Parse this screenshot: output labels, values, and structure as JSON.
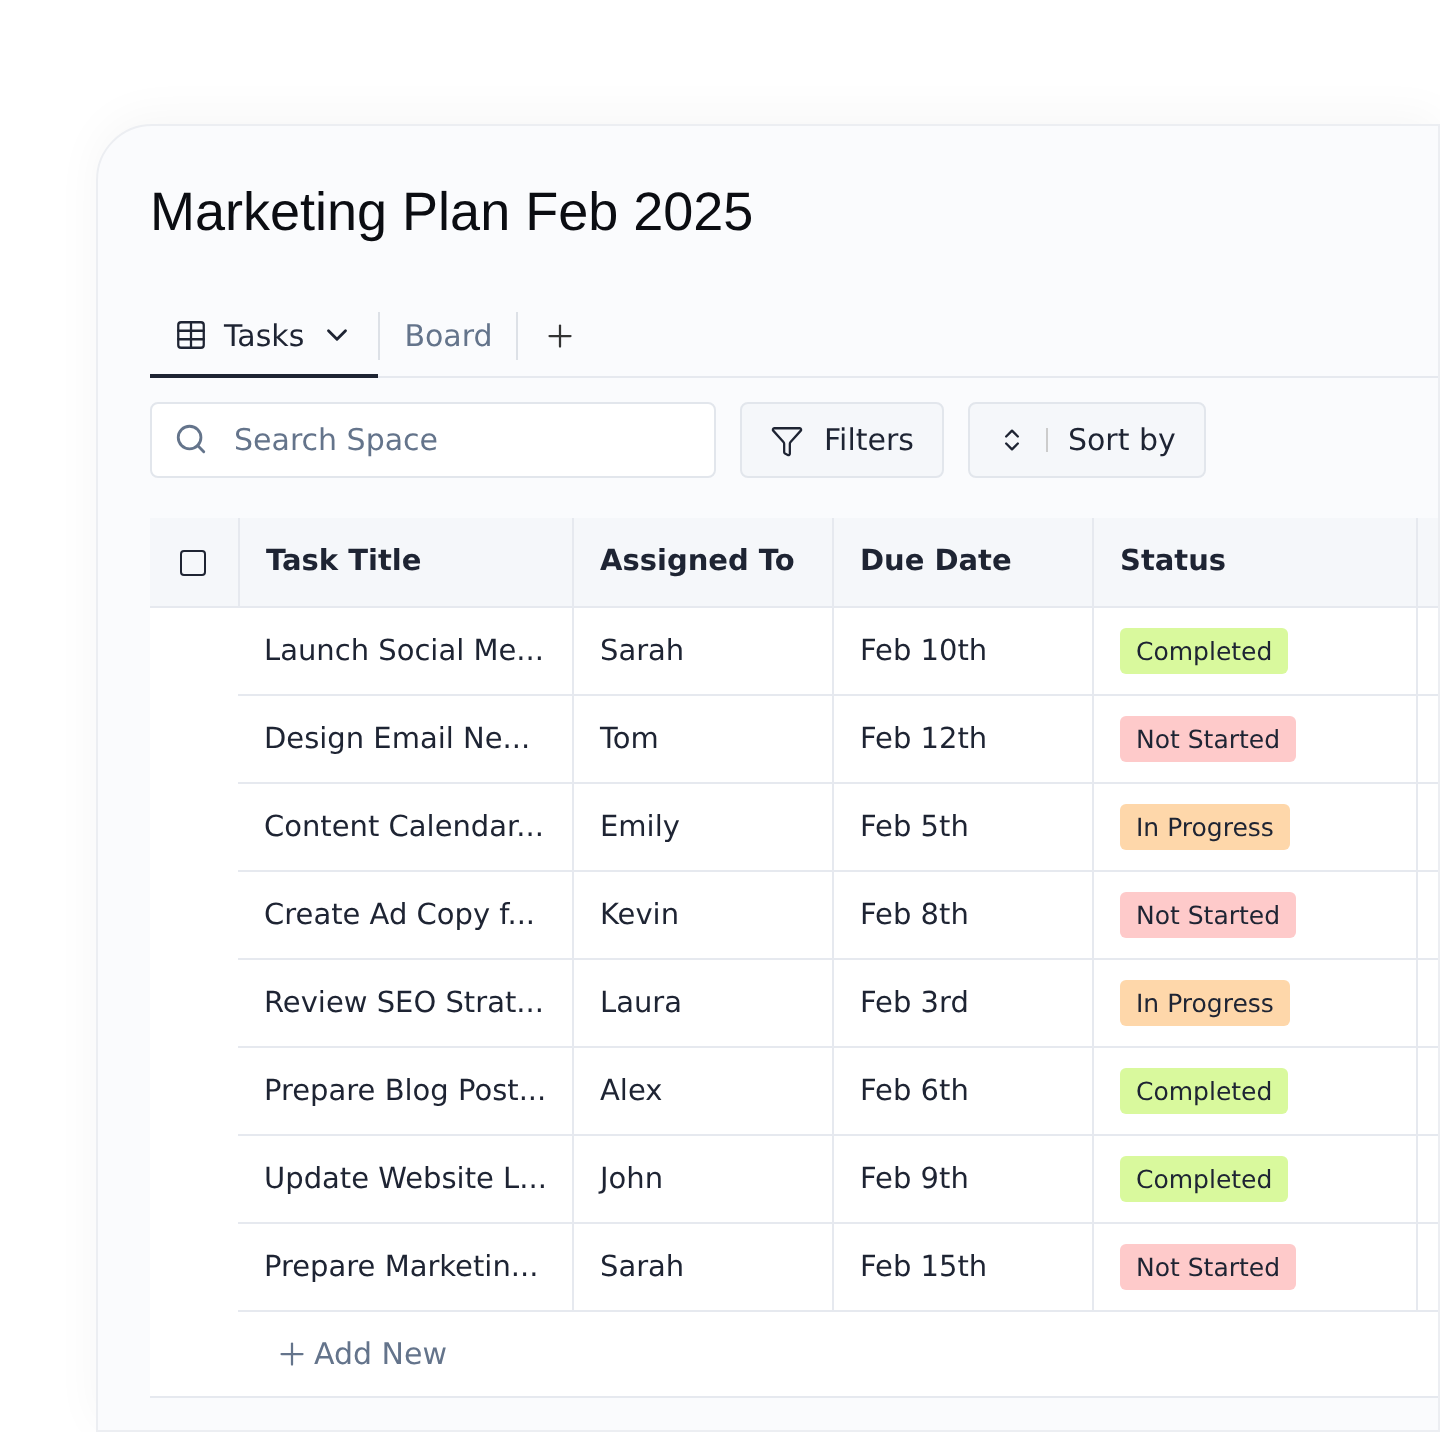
{
  "title": "Marketing Plan Feb 2025",
  "views": [
    {
      "label": "Tasks",
      "kind": "table",
      "selected": true
    },
    {
      "label": "Board",
      "kind": "plain",
      "selected": false
    }
  ],
  "search": {
    "placeholder": "Search Space"
  },
  "filters": {
    "label": "Filters"
  },
  "sort": {
    "label": "Sort by"
  },
  "table": {
    "select_all": {
      "checked": false
    },
    "columns": [
      "Task Title",
      "Assigned To",
      "Due Date",
      "Status"
    ],
    "rows": [
      {
        "title": "Launch Social Me...",
        "assignee": "Sarah",
        "due": "Feb 10th",
        "status": {
          "label": "Completed",
          "color": "#d9f99d"
        }
      },
      {
        "title": "Design Email Ne...",
        "assignee": "Tom",
        "due": "Feb 12th",
        "status": {
          "label": "Not Started",
          "color": "#fecaca"
        }
      },
      {
        "title": "Content Calendar...",
        "assignee": "Emily",
        "due": "Feb 5th",
        "status": {
          "label": "In Progress",
          "color": "#fed7aa"
        }
      },
      {
        "title": "Create Ad Copy f...",
        "assignee": "Kevin",
        "due": "Feb 8th",
        "status": {
          "label": "Not Started",
          "color": "#fecaca"
        }
      },
      {
        "title": "Review SEO Strat...",
        "assignee": "Laura",
        "due": "Feb 3rd",
        "status": {
          "label": "In Progress",
          "color": "#fed7aa"
        }
      },
      {
        "title": "Prepare Blog Post...",
        "assignee": "Alex",
        "due": "Feb 6th",
        "status": {
          "label": "Completed",
          "color": "#d9f99d"
        }
      },
      {
        "title": "Update Website L...",
        "assignee": "John",
        "due": "Feb 9th",
        "status": {
          "label": "Completed",
          "color": "#d9f99d"
        }
      },
      {
        "title": "Prepare Marketin...",
        "assignee": "Sarah",
        "due": "Feb 15th",
        "status": {
          "label": "Not Started",
          "color": "#fecaca"
        }
      }
    ],
    "add_label": "Add New"
  }
}
